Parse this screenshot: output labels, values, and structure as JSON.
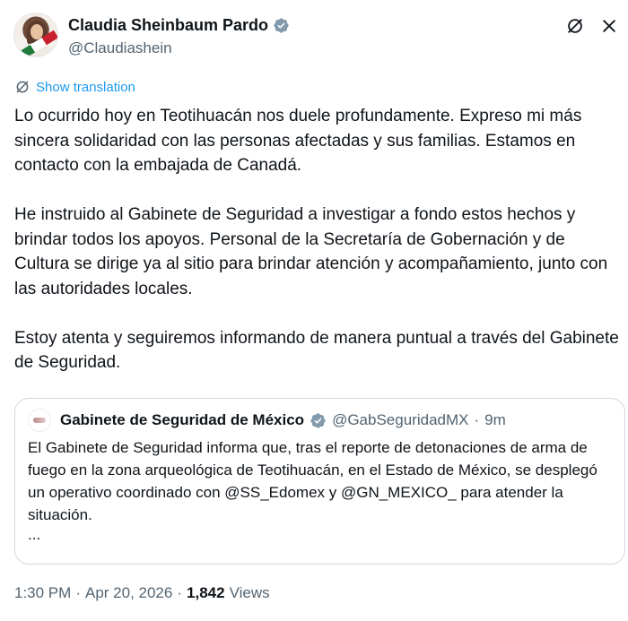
{
  "author": {
    "display_name": "Claudia Sheinbaum Pardo",
    "handle": "@Claudiashein",
    "verified_icon": "verified-badge-icon",
    "accent_color": "#1d9bf0"
  },
  "top_icons": [
    "grok-icon",
    "close-icon"
  ],
  "translation": {
    "label": "Show translation"
  },
  "tweet": {
    "paragraphs": [
      "Lo ocurrido hoy en Teotihuacán nos duele profundamente. Expreso mi más sincera solidaridad con las personas afectadas y sus familias. Estamos en contacto con la embajada de Canadá.",
      "He instruido al Gabinete de Seguridad a investigar a fondo estos hechos y brindar todos los apoyos. Personal de la Secretaría de Gobernación y de Cultura se dirige ya al sitio para brindar atención y acompañamiento, junto con las autoridades locales.",
      "Estoy atenta y seguiremos informando de manera puntual a través del Gabinete de Seguridad."
    ]
  },
  "quote": {
    "display_name": "Gabinete de Seguridad de México",
    "handle": "@GabSeguridadMX",
    "separator": "·",
    "time": "9m",
    "text": "El Gabinete de Seguridad informa que, tras el reporte de detonaciones de arma de fuego en la zona arqueológica de Teotihuacán, en el Estado de México, se desplegó un operativo coordinado con @SS_Edomex y @GN_MEXICO_ para atender la situación.",
    "more": "..."
  },
  "meta": {
    "time": "1:30 PM",
    "sep1": "·",
    "date": "Apr 20, 2026",
    "sep2": "·",
    "views_count": "1,842",
    "views_label": "Views"
  }
}
